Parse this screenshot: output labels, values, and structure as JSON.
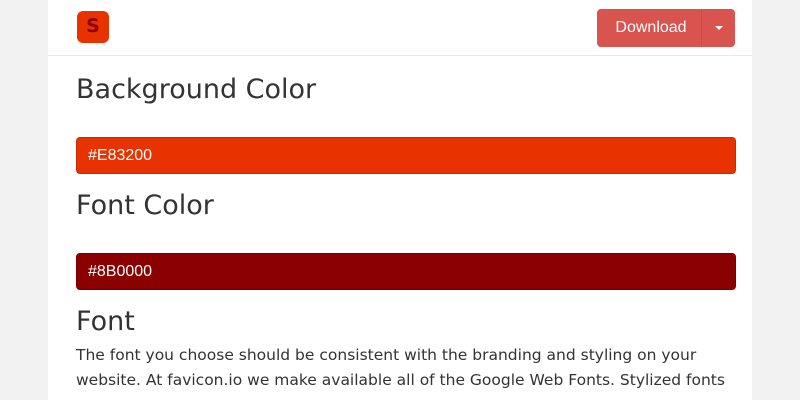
{
  "colors": {
    "logo_bg": "#E83200",
    "logo_fg": "#8B0000",
    "download_button": "#d9534f"
  },
  "header": {
    "logo_letter": "S",
    "download_label": "Download"
  },
  "sections": {
    "background_color": {
      "title": "Background Color",
      "value": "#E83200"
    },
    "font_color": {
      "title": "Font Color",
      "value": "#8B0000"
    },
    "font": {
      "title": "Font",
      "description_line1": "The font you choose should be consistent with the branding and styling on your",
      "description_line2": "website. At favicon.io we make available all of the Google Web Fonts. Stylized fonts"
    }
  }
}
